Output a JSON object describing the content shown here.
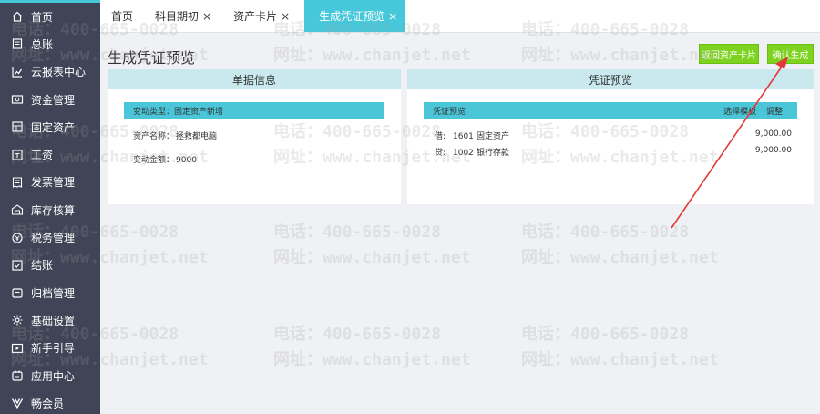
{
  "sidebar": {
    "items": [
      {
        "label": "首页",
        "icon": "home-icon"
      },
      {
        "label": "总账",
        "icon": "ledger-icon"
      },
      {
        "label": "云报表中心",
        "icon": "chart-icon"
      },
      {
        "label": "资金管理",
        "icon": "money-icon"
      },
      {
        "label": "固定资产",
        "icon": "asset-icon"
      },
      {
        "label": "工资",
        "icon": "salary-icon"
      },
      {
        "label": "发票管理",
        "icon": "invoice-icon"
      },
      {
        "label": "库存核算",
        "icon": "warehouse-icon"
      },
      {
        "label": "税务管理",
        "icon": "tax-icon"
      },
      {
        "label": "结账",
        "icon": "checkout-icon"
      },
      {
        "label": "归档管理",
        "icon": "archive-icon"
      },
      {
        "label": "基础设置",
        "icon": "settings-icon"
      },
      {
        "label": "新手引导",
        "icon": "guide-icon"
      },
      {
        "label": "应用中心",
        "icon": "app-icon"
      },
      {
        "label": "畅会员",
        "icon": "vip-icon"
      }
    ]
  },
  "tabs": [
    {
      "label": "首页",
      "closable": false
    },
    {
      "label": "科目期初",
      "closable": true
    },
    {
      "label": "资产卡片",
      "closable": true
    },
    {
      "label": "生成凭证预览",
      "closable": true,
      "active": true
    }
  ],
  "tab_close_glyph": "×",
  "page": {
    "title": "生成凭证预览",
    "back_button": "返回资产卡片",
    "confirm_button": "确认生成"
  },
  "doc_panel": {
    "title": "单据信息",
    "change_type_label": "变动类型：",
    "change_type_value": "固定资产新增",
    "asset_name_label": "资产名称：",
    "asset_name_value": "拯救都电脑",
    "change_amount_label": "变动金额：",
    "change_amount_value": "9000"
  },
  "voucher_panel": {
    "title": "凭证预览",
    "header_label": "凭证预览",
    "select_template": "选择模板",
    "adjust": "调整",
    "rows": [
      {
        "dc": "借:",
        "code": "1601",
        "name": "固定资产",
        "amount": "9,000.00"
      },
      {
        "dc": "贷:",
        "code": "1002",
        "name": "银行存款",
        "amount": "9,000.00"
      }
    ]
  },
  "watermark": {
    "phone": "电话：400-665-0028",
    "site": "网址：www.chanjet.net"
  },
  "colors": {
    "sidebar_bg": "#3f4456",
    "accent_cyan": "#47c8da",
    "button_green": "#7ed321",
    "arrow_red": "#e03a3a"
  }
}
